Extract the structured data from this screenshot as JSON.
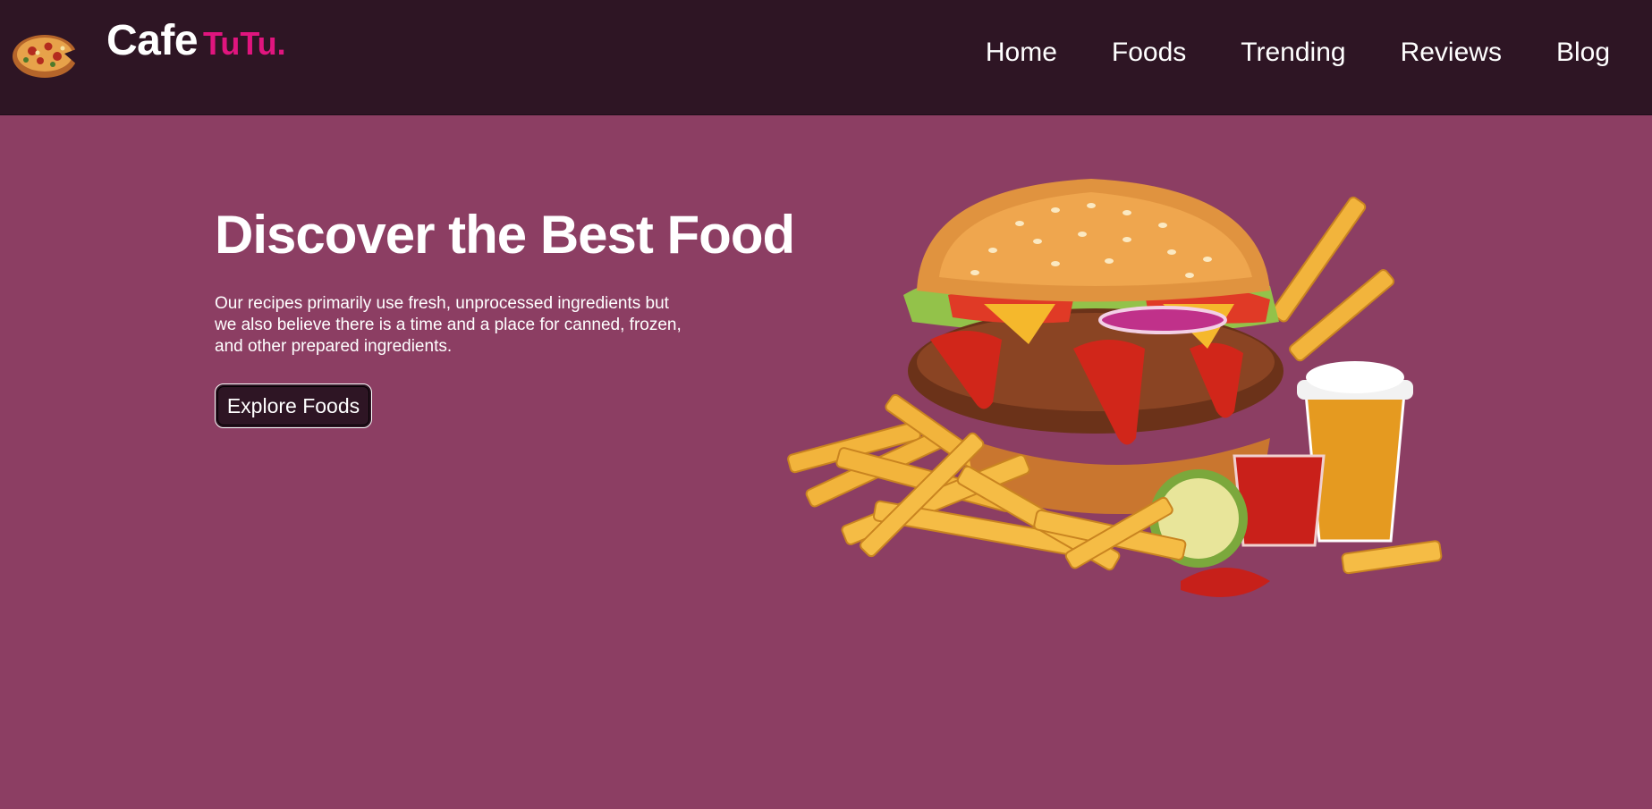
{
  "header": {
    "logo_icon": "pizza-icon",
    "brand_main": "Cafe",
    "brand_accent": "TuTu.",
    "nav": [
      {
        "label": "Home"
      },
      {
        "label": "Foods"
      },
      {
        "label": "Trending"
      },
      {
        "label": "Reviews"
      },
      {
        "label": "Blog"
      }
    ]
  },
  "hero": {
    "title": "Discover the Best Food",
    "description": "Our recipes primarily use fresh, unprocessed ingredients but we also believe there is a time and a place for canned, frozen, and other prepared ingredients.",
    "button_label": "Explore Foods",
    "image_icon": "burger-fries-icon"
  },
  "colors": {
    "header_bg": "#2e1524",
    "page_bg": "#8c3e63",
    "accent": "#e0157e",
    "text": "#ffffff"
  }
}
